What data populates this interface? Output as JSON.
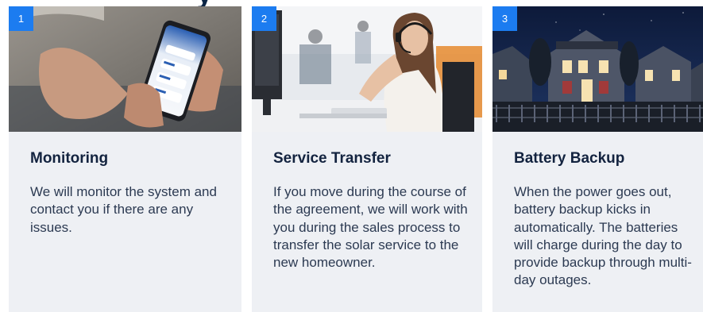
{
  "cards": [
    {
      "number": "1",
      "title": "Monitoring",
      "body": "We will monitor the system and contact you if there are any issues.",
      "image": "hands-holding-phone-monitoring-app"
    },
    {
      "number": "2",
      "title": "Service Transfer",
      "body": "If you move during the course of the agreement, we will work with you during the sales process to transfer the solar service to the new homeowner.",
      "image": "customer-service-agent-headset"
    },
    {
      "number": "3",
      "title": "Battery Backup",
      "body": "When the power goes out, battery backup kicks in automatically. The batteries will charge during the day to provide backup through multi-day outages.",
      "image": "houses-at-night"
    }
  ],
  "colors": {
    "badge": "#1c7cf0",
    "card_background": "#eef0f4",
    "title": "#13233f",
    "body": "#2c3a52"
  }
}
